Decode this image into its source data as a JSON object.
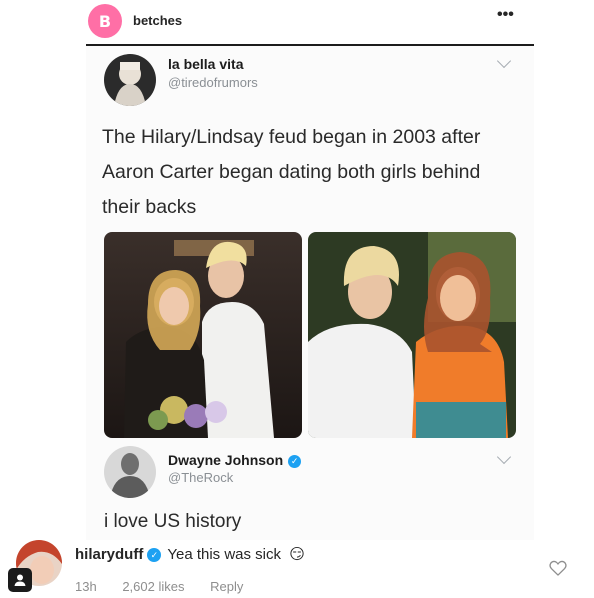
{
  "post": {
    "avatar_letter": "B",
    "username": "betches",
    "more_icon": "more-horizontal-icon"
  },
  "tweet": {
    "name": "la bella vita",
    "handle": "@tiredofrumors",
    "text": "The Hilary/Lindsay feud began in 2003 after Aaron Carter began dating both girls behind their backs"
  },
  "reply_tweet": {
    "name": "Dwayne Johnson",
    "handle": "@TheRock",
    "text": "i love US history"
  },
  "comment": {
    "username": "hilaryduff",
    "text": "Yea this was sick",
    "emoji": "😏",
    "time": "13h",
    "likes": "2,602 likes",
    "reply_label": "Reply"
  },
  "colors": {
    "betches_pink": "#ff6fa6",
    "twitter_blue": "#1da1f2",
    "meta_grey": "#8e8e8e"
  }
}
